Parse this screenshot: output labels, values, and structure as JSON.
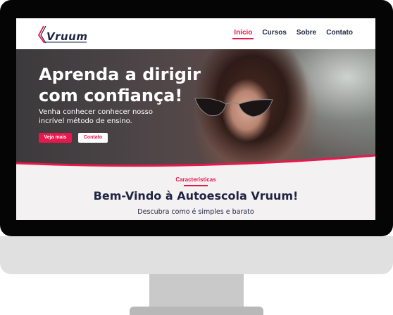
{
  "site": {
    "logo_text": "Vruum",
    "nav": [
      {
        "label": "Início",
        "active": true
      },
      {
        "label": "Cursos",
        "active": false
      },
      {
        "label": "Sobre",
        "active": false
      },
      {
        "label": "Contato",
        "active": false
      }
    ]
  },
  "hero": {
    "title": "Aprenda a dirigir com confiança!",
    "subtitle": "Venha conhecer conhecer nosso incrível método de ensino.",
    "primary_button": "Veja mais",
    "secondary_button": "Contato"
  },
  "features": {
    "label": "Características",
    "title": "Bem-Vindo à Autoescola Vruum!",
    "subtitle": "Descubra como é simples e barato"
  },
  "colors": {
    "accent": "#e8174d",
    "navy": "#1f2442",
    "monitor_frame": "#050505",
    "monitor_chin": "#e0e0e0"
  }
}
